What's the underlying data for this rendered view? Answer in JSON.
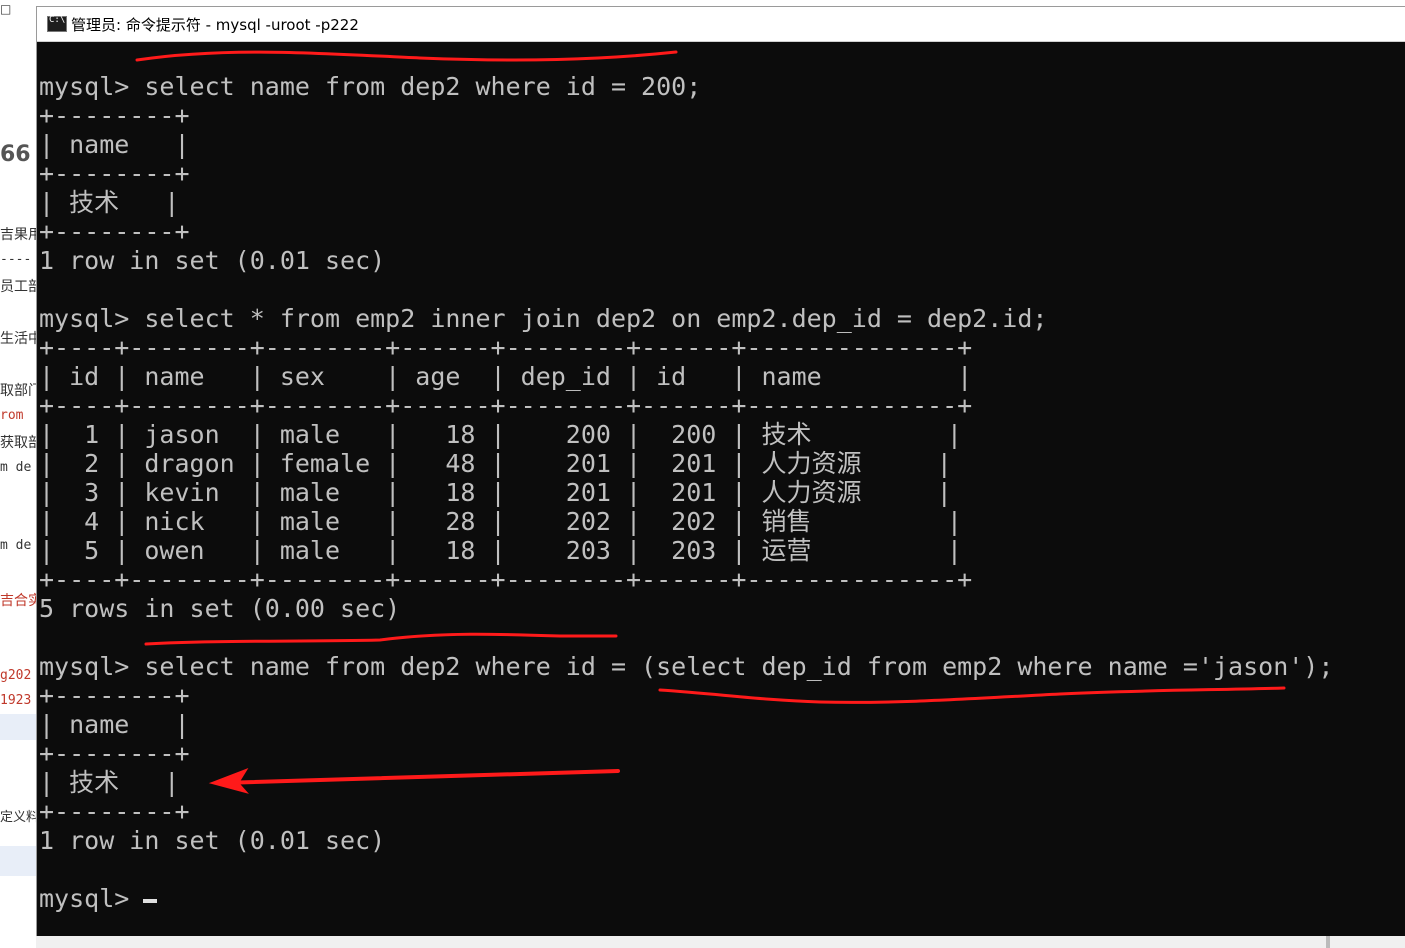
{
  "window": {
    "title": "管理员: 命令提示符 - mysql  -uroot -p222",
    "icon": "cmd-console-icon"
  },
  "background": {
    "quote_glyph": "66",
    "fragments": [
      "吉果用",
      "----",
      "员工部",
      "生活中",
      "取部门",
      "rom",
      "获取部",
      "m de",
      "m de",
      "吉合实",
      "g202",
      "1923",
      "定义料"
    ]
  },
  "terminal": {
    "lines": [
      "mysql> select name from dep2 where id = 200;",
      "+--------+",
      "| name   |",
      "+--------+",
      "| 技术   |",
      "+--------+",
      "1 row in set (0.01 sec)",
      "",
      "mysql> select * from emp2 inner join dep2 on emp2.dep_id = dep2.id;",
      "+----+--------+--------+------+--------+------+--------------+",
      "| id | name   | sex    | age  | dep_id | id   | name         |",
      "+----+--------+--------+------+--------+------+--------------+",
      "|  1 | jason  | male   |   18 |    200 |  200 | 技术         |",
      "|  2 | dragon | female |   48 |    201 |  201 | 人力资源     |",
      "|  3 | kevin  | male   |   18 |    201 |  201 | 人力资源     |",
      "|  4 | nick   | male   |   28 |    202 |  202 | 销售         |",
      "|  5 | owen   | male   |   18 |    203 |  203 | 运营         |",
      "+----+--------+--------+------+--------+------+--------------+",
      "5 rows in set (0.00 sec)",
      "",
      "mysql> select name from dep2 where id = (select dep_id from emp2 where name ='jason');",
      "+--------+",
      "| name   |",
      "+--------+",
      "| 技术   |",
      "+--------+",
      "1 row in set (0.01 sec)",
      "",
      "mysql>"
    ]
  },
  "annotations": {
    "color": "#ff1a1a"
  }
}
